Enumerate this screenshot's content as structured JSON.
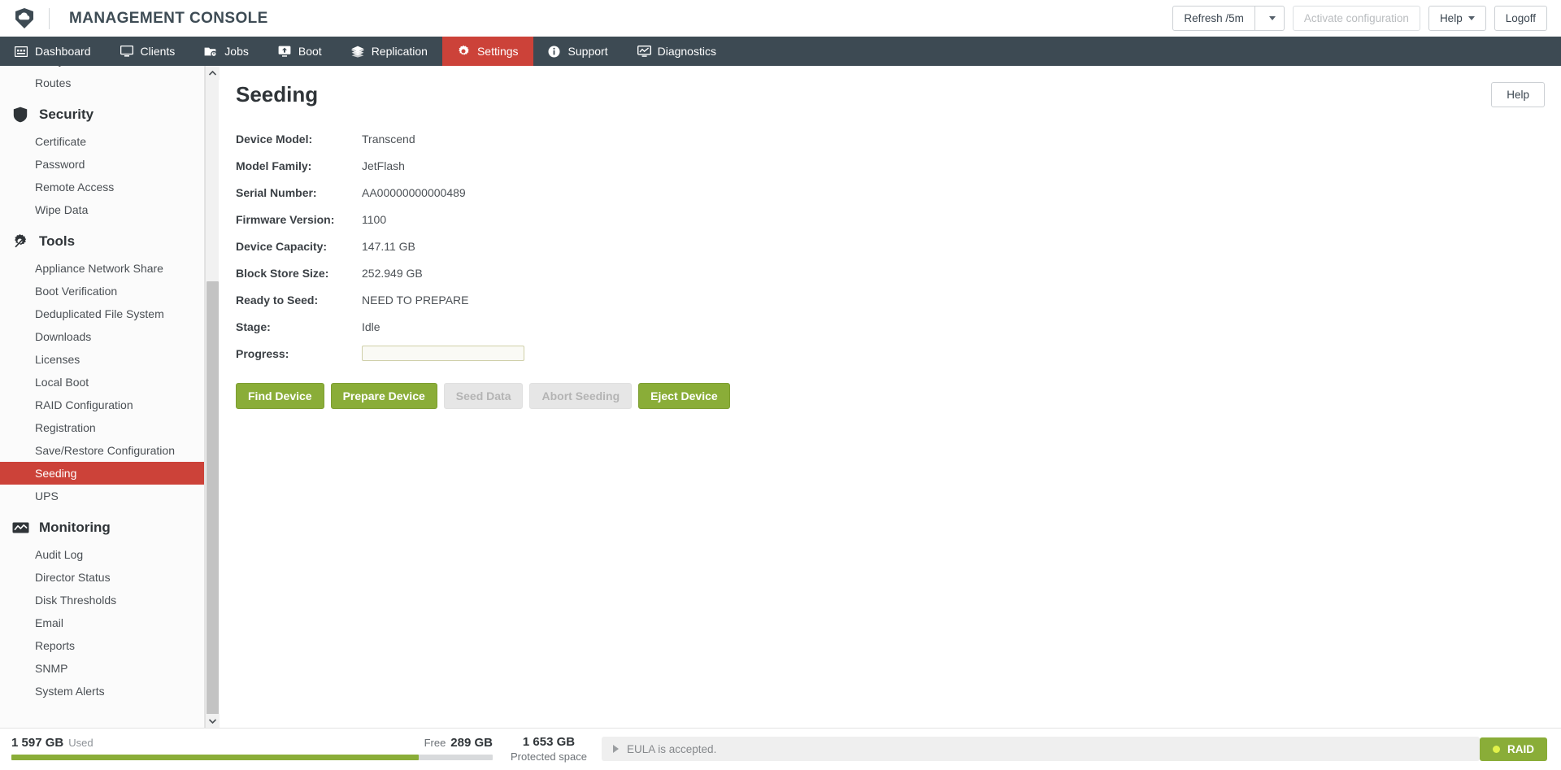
{
  "header": {
    "logo_icon": "cloud-shield-logo",
    "title": "MANAGEMENT CONSOLE",
    "refresh_label": "Refresh /5m",
    "activate_label": "Activate configuration",
    "help_label": "Help",
    "logoff_label": "Logoff"
  },
  "nav": {
    "items": [
      {
        "label": "Dashboard",
        "icon": "dashboard-icon",
        "active": false
      },
      {
        "label": "Clients",
        "icon": "monitor-icon",
        "active": false
      },
      {
        "label": "Jobs",
        "icon": "jobs-icon",
        "active": false
      },
      {
        "label": "Boot",
        "icon": "boot-upload-icon",
        "active": false
      },
      {
        "label": "Replication",
        "icon": "layers-icon",
        "active": false
      },
      {
        "label": "Settings",
        "icon": "gear-icon",
        "active": true
      },
      {
        "label": "Support",
        "icon": "info-icon",
        "active": false
      },
      {
        "label": "Diagnostics",
        "icon": "chart-monitor-icon",
        "active": false
      }
    ]
  },
  "sidebar": {
    "top_partial_items": [
      {
        "label": "Proxy"
      },
      {
        "label": "Routes"
      }
    ],
    "groups": [
      {
        "title": "Security",
        "icon": "shield-icon",
        "items": [
          {
            "label": "Certificate",
            "selected": false
          },
          {
            "label": "Password",
            "selected": false
          },
          {
            "label": "Remote Access",
            "selected": false
          },
          {
            "label": "Wipe Data",
            "selected": false
          }
        ]
      },
      {
        "title": "Tools",
        "icon": "tools-gear-icon",
        "items": [
          {
            "label": "Appliance Network Share",
            "selected": false
          },
          {
            "label": "Boot Verification",
            "selected": false
          },
          {
            "label": "Deduplicated File System",
            "selected": false
          },
          {
            "label": "Downloads",
            "selected": false
          },
          {
            "label": "Licenses",
            "selected": false
          },
          {
            "label": "Local Boot",
            "selected": false
          },
          {
            "label": "RAID Configuration",
            "selected": false
          },
          {
            "label": "Registration",
            "selected": false
          },
          {
            "label": "Save/Restore Configuration",
            "selected": false
          },
          {
            "label": "Seeding",
            "selected": true
          },
          {
            "label": "UPS",
            "selected": false
          }
        ]
      },
      {
        "title": "Monitoring",
        "icon": "monitoring-chart-icon",
        "items": [
          {
            "label": "Audit Log",
            "selected": false
          },
          {
            "label": "Director Status",
            "selected": false
          },
          {
            "label": "Disk Thresholds",
            "selected": false
          },
          {
            "label": "Email",
            "selected": false
          },
          {
            "label": "Reports",
            "selected": false
          },
          {
            "label": "SNMP",
            "selected": false
          },
          {
            "label": "System Alerts",
            "selected": false
          }
        ]
      }
    ]
  },
  "main": {
    "page_title": "Seeding",
    "help_label": "Help",
    "fields": [
      {
        "label": "Device Model:",
        "value": "Transcend"
      },
      {
        "label": "Model Family:",
        "value": "JetFlash"
      },
      {
        "label": "Serial Number:",
        "value": "AA00000000000489"
      },
      {
        "label": "Firmware Version:",
        "value": "1100"
      },
      {
        "label": "Device Capacity:",
        "value": "147.11 GB"
      },
      {
        "label": "Block Store Size:",
        "value": "252.949 GB"
      },
      {
        "label": "Ready to Seed:",
        "value": "NEED TO PREPARE"
      },
      {
        "label": "Stage:",
        "value": "Idle"
      }
    ],
    "progress": {
      "label": "Progress:",
      "percent": 0,
      "text": ""
    },
    "buttons": [
      {
        "label": "Find Device",
        "enabled": true
      },
      {
        "label": "Prepare Device",
        "enabled": true
      },
      {
        "label": "Seed Data",
        "enabled": false
      },
      {
        "label": "Abort Seeding",
        "enabled": false
      },
      {
        "label": "Eject Device",
        "enabled": true
      }
    ]
  },
  "statusbar": {
    "used_value": "1 597 GB",
    "used_label": "Used",
    "free_label": "Free",
    "free_value": "289 GB",
    "used_percent": 84.7,
    "protected_value": "1 653 GB",
    "protected_label": "Protected space",
    "eula_text": "EULA is accepted.",
    "raid_label": "RAID",
    "raid_status_color": "#e2f24a"
  },
  "colors": {
    "accent_red": "#cc4239",
    "nav_dark": "#3d4a53",
    "action_green": "#8aad38"
  }
}
